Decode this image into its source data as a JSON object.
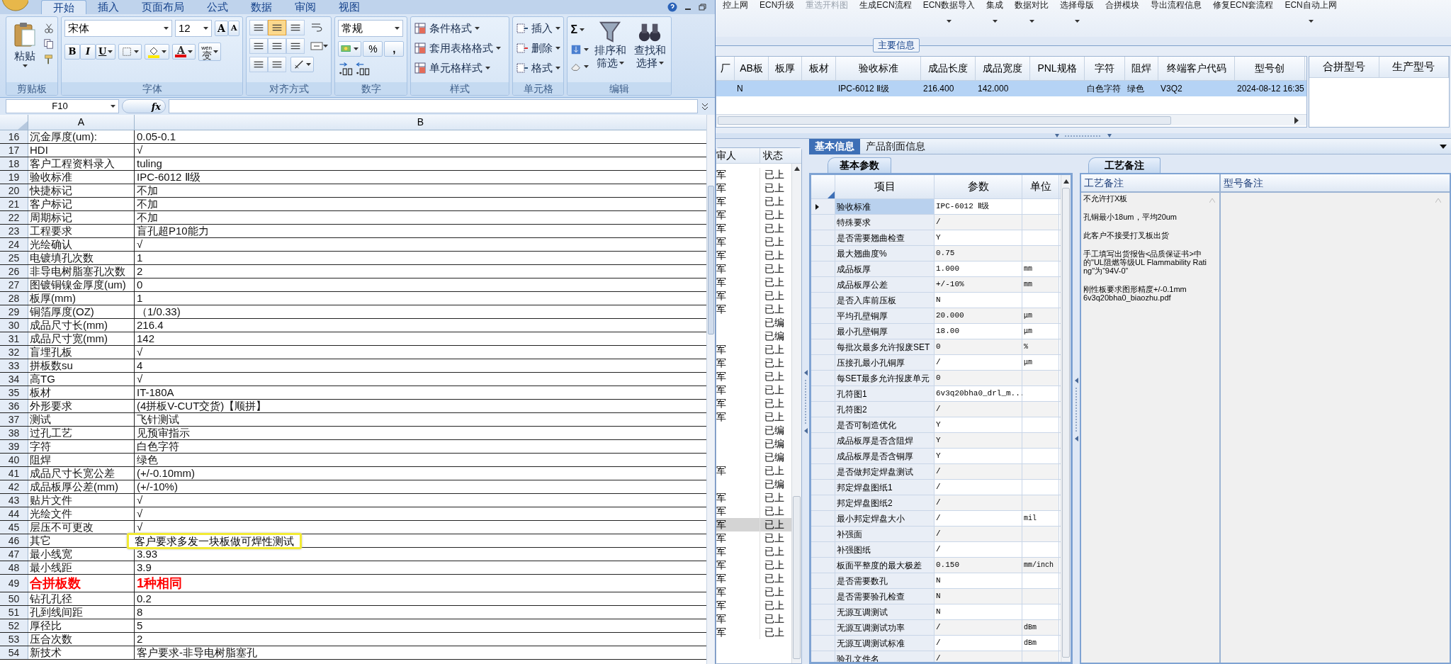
{
  "excel": {
    "tabs": [
      {
        "label": "开始",
        "selected": true
      },
      {
        "label": "插入",
        "selected": false
      },
      {
        "label": "页面布局",
        "selected": false
      },
      {
        "label": "公式",
        "selected": false
      },
      {
        "label": "数据",
        "selected": false
      },
      {
        "label": "审阅",
        "selected": false
      },
      {
        "label": "视图",
        "selected": false
      }
    ],
    "ribbon": {
      "clipboard": {
        "label": "剪贴板",
        "paste": "粘贴"
      },
      "font": {
        "label": "字体",
        "font_name": "宋体",
        "font_size": "12",
        "grow": "A",
        "shrink": "A",
        "bold": "B",
        "italic": "I",
        "underline": "U",
        "font_color": "A",
        "phonetic": "wén",
        "phonetic_char": "变"
      },
      "alignment": {
        "label": "对齐方式"
      },
      "number": {
        "label": "数字",
        "format": "常规",
        "percent": "%",
        "comma": ","
      },
      "styles": {
        "label": "样式",
        "buttons": [
          "条件格式",
          "套用表格格式",
          "单元格样式"
        ]
      },
      "cells": {
        "label": "单元格",
        "buttons": [
          "插入",
          "删除",
          "格式"
        ]
      },
      "editing": {
        "label": "编辑",
        "autosum": "Σ",
        "buttons": [
          {
            "lines": [
              "排序和",
              "筛选"
            ]
          },
          {
            "lines": [
              "查找和",
              "选择"
            ]
          }
        ]
      }
    },
    "name_box": "F10",
    "fx": "fx",
    "columns": [
      "A",
      "B"
    ],
    "rows": [
      {
        "n": "16",
        "a": "沉金厚度(um):",
        "b": "0.05-0.1",
        "kind": "normal"
      },
      {
        "n": "17",
        "a": "HDI",
        "b": "√",
        "kind": "normal"
      },
      {
        "n": "18",
        "a": "客户工程资料录入",
        "b": "tuling",
        "kind": "normal"
      },
      {
        "n": "19",
        "a": "验收标准",
        "b": "IPC-6012 Ⅱ级",
        "kind": "normal"
      },
      {
        "n": "20",
        "a": "快捷标记",
        "b": "不加",
        "kind": "normal"
      },
      {
        "n": "21",
        "a": "客户标记",
        "b": "不加",
        "kind": "normal"
      },
      {
        "n": "22",
        "a": "周期标记",
        "b": "不加",
        "kind": "normal"
      },
      {
        "n": "23",
        "a": "工程要求",
        "b": "盲孔超P10能力",
        "kind": "normal"
      },
      {
        "n": "24",
        "a": "光绘确认",
        "b": "√",
        "kind": "normal"
      },
      {
        "n": "25",
        "a": "电镀填孔次数",
        "b": "1",
        "kind": "normal"
      },
      {
        "n": "26",
        "a": "非导电树脂塞孔次数",
        "b": "2",
        "kind": "normal"
      },
      {
        "n": "27",
        "a": "图镀铜镍金厚度(um)",
        "b": "0",
        "kind": "normal"
      },
      {
        "n": "28",
        "a": "板厚(mm)",
        "b": "1",
        "kind": "normal"
      },
      {
        "n": "29",
        "a": "铜箔厚度(OZ)",
        "b": "（1/0.33)",
        "kind": "normal"
      },
      {
        "n": "30",
        "a": "成品尺寸长(mm)",
        "b": "216.4",
        "kind": "normal"
      },
      {
        "n": "31",
        "a": "成品尺寸宽(mm)",
        "b": "142",
        "kind": "normal"
      },
      {
        "n": "32",
        "a": "盲埋孔板",
        "b": "√",
        "kind": "normal"
      },
      {
        "n": "33",
        "a": "拼板数su",
        "b": "4",
        "kind": "normal"
      },
      {
        "n": "34",
        "a": "高TG",
        "b": "√",
        "kind": "normal"
      },
      {
        "n": "35",
        "a": "板材",
        "b": "IT-180A",
        "kind": "normal"
      },
      {
        "n": "36",
        "a": "外形要求",
        "b": "(4拼板V-CUT交货)【顺拼】",
        "kind": "normal"
      },
      {
        "n": "37",
        "a": "测试",
        "b": "飞针测试",
        "kind": "normal"
      },
      {
        "n": "38",
        "a": "过孔工艺",
        "b": "见预审指示",
        "kind": "normal"
      },
      {
        "n": "39",
        "a": "字符",
        "b": "白色字符",
        "kind": "normal"
      },
      {
        "n": "40",
        "a": "阻焊",
        "b": "绿色",
        "kind": "normal"
      },
      {
        "n": "41",
        "a": "成品尺寸长宽公差",
        "b": "(+/-0.10mm)",
        "kind": "normal"
      },
      {
        "n": "42",
        "a": "成品板厚公差(mm)",
        "b": "(+/-10%)",
        "kind": "normal"
      },
      {
        "n": "43",
        "a": "贴片文件",
        "b": "√",
        "kind": "normal"
      },
      {
        "n": "44",
        "a": "光绘文件",
        "b": "√",
        "kind": "normal"
      },
      {
        "n": "45",
        "a": "层压不可更改",
        "b": "√",
        "kind": "normal"
      },
      {
        "n": "46",
        "a": "其它",
        "b": "客户要求多发一块板做可焊性测试",
        "kind": "callout"
      },
      {
        "n": "47",
        "a": "最小线宽",
        "b": "3.93",
        "kind": "normal"
      },
      {
        "n": "48",
        "a": "最小线距",
        "b": "3.9",
        "kind": "normal"
      },
      {
        "n": "49",
        "a": "合拼板数",
        "b": "1种相同",
        "kind": "emphasis"
      },
      {
        "n": "50",
        "a": "钻孔孔径",
        "b": "0.2",
        "kind": "normal"
      },
      {
        "n": "51",
        "a": "孔到线间距",
        "b": "8",
        "kind": "normal"
      },
      {
        "n": "52",
        "a": "厚径比",
        "b": "5",
        "kind": "normal"
      },
      {
        "n": "53",
        "a": "压合次数",
        "b": "2",
        "kind": "normal"
      },
      {
        "n": "54",
        "a": "新技术",
        "b": "客户要求-非导电树脂塞孔",
        "kind": "normal"
      }
    ]
  },
  "app": {
    "toolbar": [
      {
        "label": "控上网",
        "disabled": false,
        "has_menu": false
      },
      {
        "label": "ECN升级",
        "disabled": false,
        "has_menu": false
      },
      {
        "label": "重选开料图",
        "disabled": true,
        "has_menu": false
      },
      {
        "label": "生成ECN流程",
        "disabled": false,
        "has_menu": false
      },
      {
        "label": "ECN数据导入",
        "disabled": false,
        "has_menu": true
      },
      {
        "label": "集成",
        "disabled": false,
        "has_menu": true
      },
      {
        "label": "数据对比",
        "disabled": false,
        "has_menu": true
      },
      {
        "label": "选择母版",
        "disabled": false,
        "has_menu": true
      },
      {
        "label": "合拼模块",
        "disabled": false,
        "has_menu": false
      },
      {
        "label": "导出流程信息",
        "disabled": false,
        "has_menu": false
      },
      {
        "label": "修复ECN套流程",
        "disabled": false,
        "has_menu": false
      },
      {
        "label": "ECN自动上网",
        "disabled": false,
        "has_menu": true
      }
    ],
    "main_info": {
      "title": "主要信息",
      "columns": [
        "厂",
        "AB板",
        "板厚",
        "板材",
        "验收标准",
        "成品长度",
        "成品宽度",
        "PNL规格",
        "字符",
        "阻焊",
        "终端客户代码",
        "型号创"
      ],
      "rows": [
        {
          "cells": [
            "",
            "N",
            "",
            "",
            "IPC-6012 Ⅱ级",
            "216.400",
            "142.000",
            "",
            "白色字符",
            "绿色",
            "V3Q2",
            "2024-08-12 16:35"
          ],
          "selected": true
        }
      ],
      "side_columns": [
        "合拼型号",
        "生产型号"
      ]
    },
    "reviewer_list": {
      "columns": [
        "审人",
        "状态"
      ],
      "rows": [
        {
          "reviewer": "军",
          "status": "已上",
          "selected": false
        },
        {
          "reviewer": "军",
          "status": "已上",
          "selected": false
        },
        {
          "reviewer": "军",
          "status": "已上",
          "selected": false
        },
        {
          "reviewer": "军",
          "status": "已上",
          "selected": false
        },
        {
          "reviewer": "军",
          "status": "已上",
          "selected": false
        },
        {
          "reviewer": "军",
          "status": "已上",
          "selected": false
        },
        {
          "reviewer": "军",
          "status": "已上",
          "selected": false
        },
        {
          "reviewer": "军",
          "status": "已上",
          "selected": false
        },
        {
          "reviewer": "军",
          "status": "已上",
          "selected": false
        },
        {
          "reviewer": "军",
          "status": "已上",
          "selected": false
        },
        {
          "reviewer": "军",
          "status": "已上",
          "selected": false
        },
        {
          "reviewer": "",
          "status": "已编",
          "selected": false
        },
        {
          "reviewer": "",
          "status": "已编",
          "selected": false
        },
        {
          "reviewer": "军",
          "status": "已上",
          "selected": false
        },
        {
          "reviewer": "军",
          "status": "已上",
          "selected": false
        },
        {
          "reviewer": "军",
          "status": "已上",
          "selected": false
        },
        {
          "reviewer": "军",
          "status": "已上",
          "selected": false
        },
        {
          "reviewer": "军",
          "status": "已上",
          "selected": false
        },
        {
          "reviewer": "军",
          "status": "已上",
          "selected": false
        },
        {
          "reviewer": "",
          "status": "已编",
          "selected": false
        },
        {
          "reviewer": "",
          "status": "已编",
          "selected": false
        },
        {
          "reviewer": "",
          "status": "已编",
          "selected": false
        },
        {
          "reviewer": "军",
          "status": "已上",
          "selected": false
        },
        {
          "reviewer": "",
          "status": "已编",
          "selected": false
        },
        {
          "reviewer": "军",
          "status": "已上",
          "selected": false
        },
        {
          "reviewer": "军",
          "status": "已上",
          "selected": false
        },
        {
          "reviewer": "军",
          "status": "已上",
          "selected": true
        },
        {
          "reviewer": "军",
          "status": "已上",
          "selected": false
        },
        {
          "reviewer": "军",
          "status": "已上",
          "selected": false
        },
        {
          "reviewer": "军",
          "status": "已上",
          "selected": false
        },
        {
          "reviewer": "军",
          "status": "已上",
          "selected": false
        },
        {
          "reviewer": "军",
          "status": "已上",
          "selected": false
        },
        {
          "reviewer": "军",
          "status": "已上",
          "selected": false
        },
        {
          "reviewer": "军",
          "status": "已上",
          "selected": false
        },
        {
          "reviewer": "军",
          "status": "已上",
          "selected": false
        }
      ]
    },
    "detail_tabs": [
      {
        "label": "基本信息",
        "selected": true
      },
      {
        "label": "产品剖面信息",
        "selected": false
      }
    ],
    "param_tab": "基本参数",
    "params": {
      "columns": [
        "项目",
        "参数",
        "单位"
      ],
      "rows": [
        {
          "item": "验收标准",
          "value": "IPC-6012 Ⅱ级",
          "unit": "",
          "current": true
        },
        {
          "item": "特殊要求",
          "value": "/",
          "unit": "",
          "current": false
        },
        {
          "item": "是否需要翘曲检查",
          "value": "Y",
          "unit": "",
          "current": false
        },
        {
          "item": "最大翘曲度%",
          "value": "0.75",
          "unit": "",
          "current": false
        },
        {
          "item": "成品板厚",
          "value": "1.000",
          "unit": "mm",
          "current": false
        },
        {
          "item": "成品板厚公差",
          "value": "+/-10%",
          "unit": "mm",
          "current": false
        },
        {
          "item": "是否入库前压板",
          "value": "N",
          "unit": "",
          "current": false
        },
        {
          "item": "平均孔壁铜厚",
          "value": "20.000",
          "unit": "μm",
          "current": false
        },
        {
          "item": "最小孔壁铜厚",
          "value": "18.00",
          "unit": "μm",
          "current": false
        },
        {
          "item": "每批次最多允许报废SET",
          "value": "0",
          "unit": "%",
          "current": false
        },
        {
          "item": "压接孔最小孔铜厚",
          "value": "/",
          "unit": "μm",
          "current": false
        },
        {
          "item": "每SET最多允许报废单元",
          "value": "0",
          "unit": "",
          "current": false
        },
        {
          "item": "孔符图1",
          "value": "6v3q20bha0_drl_m...",
          "unit": "",
          "current": false
        },
        {
          "item": "孔符图2",
          "value": "/",
          "unit": "",
          "current": false
        },
        {
          "item": "是否可制造优化",
          "value": "Y",
          "unit": "",
          "current": false
        },
        {
          "item": "成品板厚是否含阻焊",
          "value": "Y",
          "unit": "",
          "current": false
        },
        {
          "item": "成品板厚是否含铜厚",
          "value": "Y",
          "unit": "",
          "current": false
        },
        {
          "item": "是否做邦定焊盘测试",
          "value": "/",
          "unit": "",
          "current": false
        },
        {
          "item": "邦定焊盘图纸1",
          "value": "/",
          "unit": "",
          "current": false
        },
        {
          "item": "邦定焊盘图纸2",
          "value": "/",
          "unit": "",
          "current": false
        },
        {
          "item": "最小邦定焊盘大小",
          "value": "/",
          "unit": "mil",
          "current": false
        },
        {
          "item": "补强面",
          "value": "/",
          "unit": "",
          "current": false
        },
        {
          "item": "补强图纸",
          "value": "/",
          "unit": "",
          "current": false
        },
        {
          "item": "板面平整度的最大极差",
          "value": "0.150",
          "unit": "mm/inch",
          "current": false
        },
        {
          "item": "是否需要数孔",
          "value": "N",
          "unit": "",
          "current": false
        },
        {
          "item": "是否需要验孔检查",
          "value": "N",
          "unit": "",
          "current": false
        },
        {
          "item": "无源互调测试",
          "value": "N",
          "unit": "",
          "current": false
        },
        {
          "item": "无源互调测试功率",
          "value": "/",
          "unit": "dBm",
          "current": false
        },
        {
          "item": "无源互调测试标准",
          "value": "/",
          "unit": "dBm",
          "current": false
        },
        {
          "item": "验孔文件名",
          "value": "/",
          "unit": "",
          "current": false
        }
      ]
    },
    "notes_tab": "工艺备注",
    "notes": {
      "columns": [
        "工艺备注",
        "型号备注"
      ],
      "process_notes": [
        "不允许打X板",
        "孔铜最小18um，平均20um",
        "此客户不接受打叉板出货",
        "手工填写出货报告<品质保证书>中的\"UL阻燃等级UL Flammability Rating\"为“94V-0”",
        "刚性板要求图形精度+/-0.1mm\n6v3q20bha0_biaozhu.pdf"
      ]
    }
  }
}
